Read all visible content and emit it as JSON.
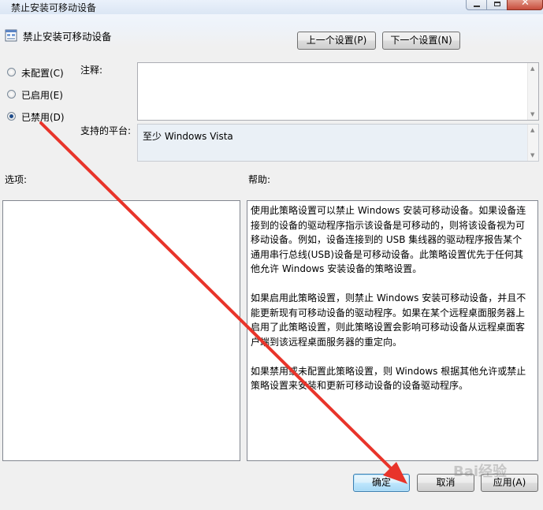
{
  "window": {
    "title": "禁止安装可移动设备"
  },
  "header": {
    "policy_name": "禁止安装可移动设备",
    "prev_button": "上一个设置(P)",
    "next_button": "下一个设置(N)"
  },
  "options": {
    "items": [
      {
        "label": "未配置(C)",
        "checked": false
      },
      {
        "label": "已启用(E)",
        "checked": false
      },
      {
        "label": "已禁用(D)",
        "checked": true
      }
    ]
  },
  "fields": {
    "comment_label": "注释:",
    "comment_value": "",
    "platform_label": "支持的平台:",
    "platform_value": "至少 Windows Vista"
  },
  "sections": {
    "options_label": "选项:",
    "help_label": "帮助:"
  },
  "help": {
    "paragraphs": [
      "使用此策略设置可以禁止 Windows 安装可移动设备。如果设备连接到的设备的驱动程序指示该设备是可移动的，则将该设备视为可移动设备。例如，设备连接到的 USB 集线器的驱动程序报告某个通用串行总线(USB)设备是可移动设备。此策略设置优先于任何其他允许 Windows 安装设备的策略设置。",
      "如果启用此策略设置，则禁止 Windows 安装可移动设备，并且不能更新现有可移动设备的驱动程序。如果在某个远程桌面服务器上启用了此策略设置，则此策略设置会影响可移动设备从远程桌面客户端到该远程桌面服务器的重定向。",
      "如果禁用或未配置此策略设置，则 Windows 根据其他允许或禁止策略设置来安装和更新可移动设备的设备驱动程序。"
    ]
  },
  "footer": {
    "ok_label": "确定",
    "cancel_label": "取消",
    "apply_label": "应用(A)"
  },
  "watermark": "Bai经验",
  "colors": {
    "annotation_arrow": "#e8342a",
    "ok_button_border": "#3c7fb1",
    "radio_dot": "#1e4c8a"
  },
  "icons": [
    "policy-icon",
    "minimize-icon",
    "maximize-icon",
    "close-icon",
    "radio-icon"
  ]
}
